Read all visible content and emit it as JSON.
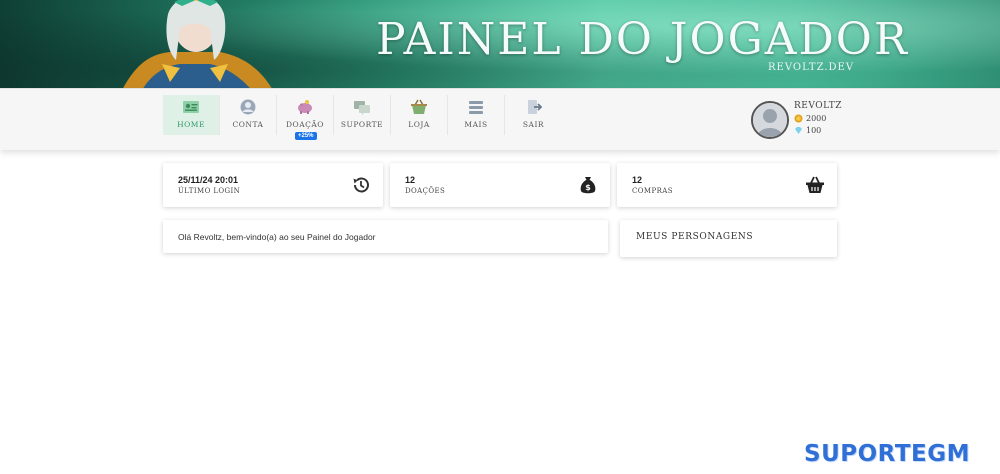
{
  "banner": {
    "title": "PAINEL DO JOGADOR",
    "subtitle": "REVOLTZ.DEV"
  },
  "nav": {
    "items": [
      {
        "label": "Home",
        "icon": "home-card-icon",
        "active": true
      },
      {
        "label": "Conta",
        "icon": "account-icon"
      },
      {
        "label": "Doação",
        "icon": "donation-piggy-icon",
        "badge": "+25%"
      },
      {
        "label": "Suporte",
        "icon": "support-chat-icon"
      },
      {
        "label": "Loja",
        "icon": "shop-basket-icon"
      },
      {
        "label": "Mais",
        "icon": "menu-icon"
      },
      {
        "label": "Sair",
        "icon": "logout-icon"
      }
    ]
  },
  "profile": {
    "name": "REVOLTZ",
    "gold": "2000",
    "diamonds": "100"
  },
  "stats": [
    {
      "value": "25/11/24 20:01",
      "label": "Último Login",
      "icon": "history-icon"
    },
    {
      "value": "12",
      "label": "Doações",
      "icon": "money-bag-icon"
    },
    {
      "value": "12",
      "label": "Compras",
      "icon": "shopping-basket-icon"
    }
  ],
  "welcome": "Olá Revoltz, bem-vindo(a) ao seu Painel do Jogador",
  "characters_title": "Meus Personagens",
  "watermark": "SUPORTEGM",
  "colors": {
    "accent": "#2e9a6a",
    "banner": "#4fc4a0",
    "badge": "#1a73e8"
  }
}
